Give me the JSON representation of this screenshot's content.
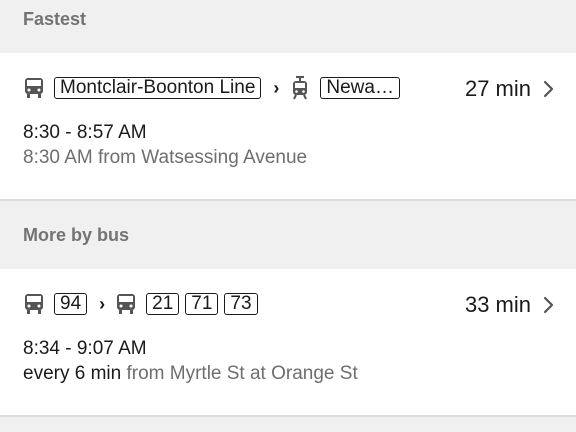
{
  "sections": [
    {
      "header": "Fastest",
      "route": {
        "legs": [
          {
            "icon": "bus-icon",
            "label": "Montclair-Boonton Line"
          },
          {
            "icon": "tram-icon",
            "label": "Newa…"
          }
        ],
        "separator": "›",
        "duration": "27 min",
        "time_range": "8:30 - 8:57 AM",
        "detail_prefix": "",
        "detail": "8:30 AM from Watsessing Avenue"
      }
    },
    {
      "header": "More by bus",
      "route": {
        "legs": [
          {
            "icon": "bus-icon",
            "labels": [
              "94"
            ]
          },
          {
            "icon": "bus-icon",
            "labels": [
              "21",
              "71",
              "73"
            ]
          }
        ],
        "separator": "›",
        "duration": "33 min",
        "time_range": "8:34 - 9:07 AM",
        "detail_prefix": "every 6 min",
        "detail": " from Myrtle St at Orange St"
      }
    }
  ],
  "colors": {
    "background": "#f0f0f0",
    "card": "#ffffff",
    "header_text": "#737373",
    "secondary_text": "#6e6e6e",
    "primary_text": "#1a1a1a"
  }
}
